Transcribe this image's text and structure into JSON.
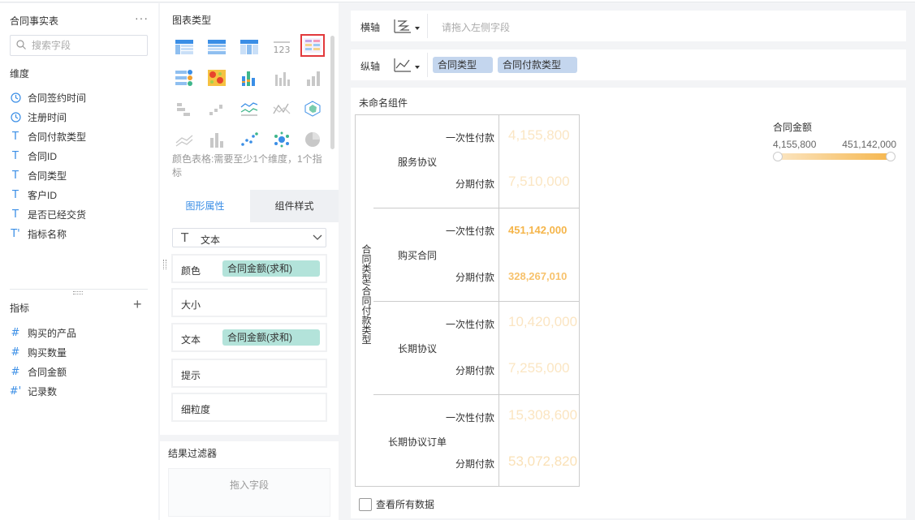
{
  "left_panel": {
    "title": "合同事实表",
    "more": "···",
    "search_placeholder": "搜索字段",
    "dimensions_label": "维度",
    "dimensions": [
      {
        "icon": "clock-icon",
        "glyph": "",
        "label": "合同签约时间"
      },
      {
        "icon": "clock-icon",
        "glyph": "",
        "label": "注册时间"
      },
      {
        "icon": "text-type-icon",
        "glyph": "T",
        "label": "合同付款类型"
      },
      {
        "icon": "text-type-icon",
        "glyph": "T",
        "label": "合同ID"
      },
      {
        "icon": "text-type-icon",
        "glyph": "T",
        "label": "合同类型"
      },
      {
        "icon": "text-type-icon",
        "glyph": "T",
        "label": "客户ID"
      },
      {
        "icon": "text-type-icon",
        "glyph": "T",
        "label": "是否已经交货"
      },
      {
        "icon": "text-calc-icon",
        "glyph": "T'",
        "label": "指标名称"
      }
    ],
    "measures_label": "指标",
    "add": "+",
    "measures": [
      {
        "icon": "number-type-icon",
        "glyph": "#",
        "label": "购买的产品"
      },
      {
        "icon": "number-type-icon",
        "glyph": "#",
        "label": "购买数量"
      },
      {
        "icon": "number-type-icon",
        "glyph": "#",
        "label": "合同金额"
      },
      {
        "icon": "number-calc-icon",
        "glyph": "#'",
        "label": "记录数"
      }
    ]
  },
  "middle_panel": {
    "chart_types_title": "图表类型",
    "hint": "颜色表格:需要至少1个维度，1个指标",
    "tabs": {
      "active": "图形属性",
      "inactive": "组件样式"
    },
    "mark_type": "文本",
    "properties": {
      "color": {
        "label": "颜色",
        "field": "合同金额(求和)"
      },
      "size": {
        "label": "大小"
      },
      "text": {
        "label": "文本",
        "field": "合同金额(求和)"
      },
      "tooltip": {
        "label": "提示"
      },
      "granularity": {
        "label": "细粒度"
      }
    },
    "filter_title": "结果过滤器",
    "filter_drop": "拖入字段"
  },
  "x_axis": {
    "label": "横轴",
    "placeholder": "请拖入左侧字段"
  },
  "y_axis": {
    "label": "纵轴",
    "fields": [
      "合同类型",
      "合同付款类型"
    ]
  },
  "canvas": {
    "title": "未命名组件",
    "row_header": "合同类型/合同付款类型",
    "show_all": "查看所有数据",
    "legend": {
      "title": "合同金额",
      "min": "4,155,800",
      "max": "451,142,000",
      "color_low": "#fbe6c4",
      "color_high": "#f5b54a"
    },
    "table": [
      {
        "category": "服务协议",
        "rows": [
          {
            "type": "一次性付款",
            "value": "4,155,800",
            "amount": 4155800
          },
          {
            "type": "分期付款",
            "value": "7,510,000",
            "amount": 7510000
          }
        ]
      },
      {
        "category": "购买合同",
        "rows": [
          {
            "type": "一次性付款",
            "value": "451,142,000",
            "amount": 451142000
          },
          {
            "type": "分期付款",
            "value": "328,267,010",
            "amount": 328267010
          }
        ]
      },
      {
        "category": "长期协议",
        "rows": [
          {
            "type": "一次性付款",
            "value": "10,420,000",
            "amount": 10420000
          },
          {
            "type": "分期付款",
            "value": "7,255,000",
            "amount": 7255000
          }
        ]
      },
      {
        "category": "长期协议订单",
        "rows": [
          {
            "type": "一次性付款",
            "value": "15,308,600",
            "amount": 15308600
          },
          {
            "type": "分期付款",
            "value": "53,072,820",
            "amount": 53072820
          }
        ]
      }
    ]
  }
}
